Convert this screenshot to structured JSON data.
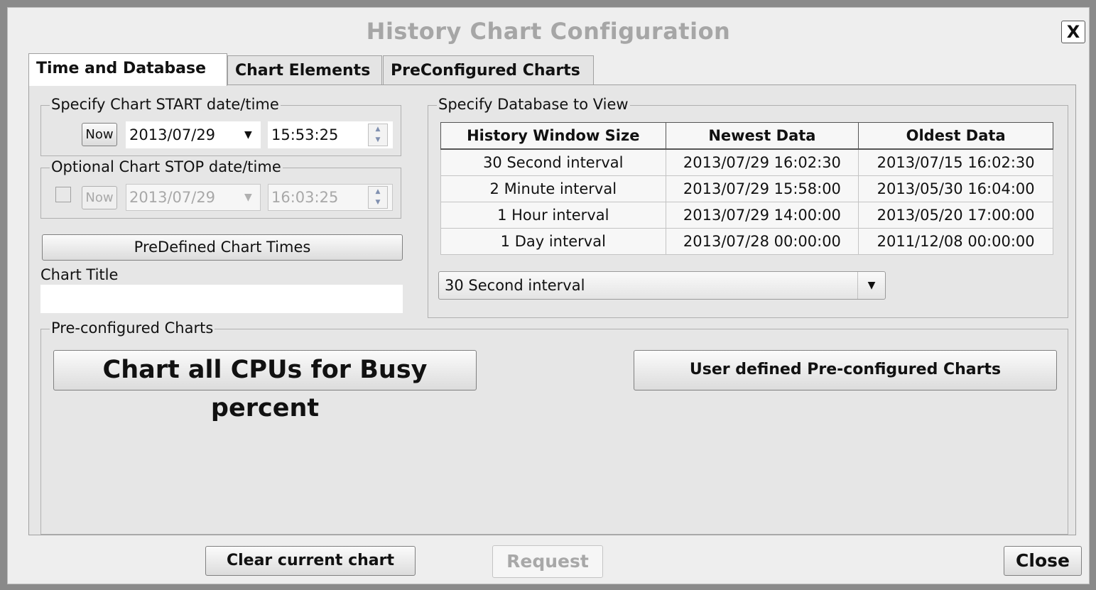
{
  "dialog": {
    "title": "History Chart Configuration",
    "close_x": "X"
  },
  "tabs": [
    {
      "label": "Time and Database"
    },
    {
      "label": "Chart Elements"
    },
    {
      "label": "PreConfigured Charts"
    }
  ],
  "start": {
    "legend": "Specify Chart START date/time",
    "now_label": "Now",
    "date": "2013/07/29",
    "time": "15:53:25"
  },
  "stop": {
    "legend": "Optional Chart STOP date/time",
    "enabled": false,
    "now_label": "Now",
    "date": "2013/07/29",
    "time": "16:03:25"
  },
  "predefined_label": "PreDefined Chart Times",
  "chart_title": {
    "label": "Chart Title",
    "value": ""
  },
  "database": {
    "legend": "Specify Database to View",
    "columns": [
      "History Window Size",
      "Newest Data",
      "Oldest Data"
    ],
    "rows": [
      [
        "30 Second interval",
        "2013/07/29 16:02:30",
        "2013/07/15 16:02:30"
      ],
      [
        "2 Minute interval",
        "2013/07/29 15:58:00",
        "2013/05/30 16:04:00"
      ],
      [
        "1 Hour interval",
        "2013/07/29 14:00:00",
        "2013/05/20 17:00:00"
      ],
      [
        "1 Day interval",
        "2013/07/28 00:00:00",
        "2011/12/08 00:00:00"
      ]
    ],
    "selected": "30 Second interval"
  },
  "preconfigured": {
    "legend": "Pre-configured Charts",
    "cpu_button": "Chart all CPUs for Busy percent",
    "user_button": "User defined Pre-configured Charts"
  },
  "footer": {
    "clear_label": "Clear current chart",
    "request_label": "Request",
    "close_label": "Close"
  }
}
